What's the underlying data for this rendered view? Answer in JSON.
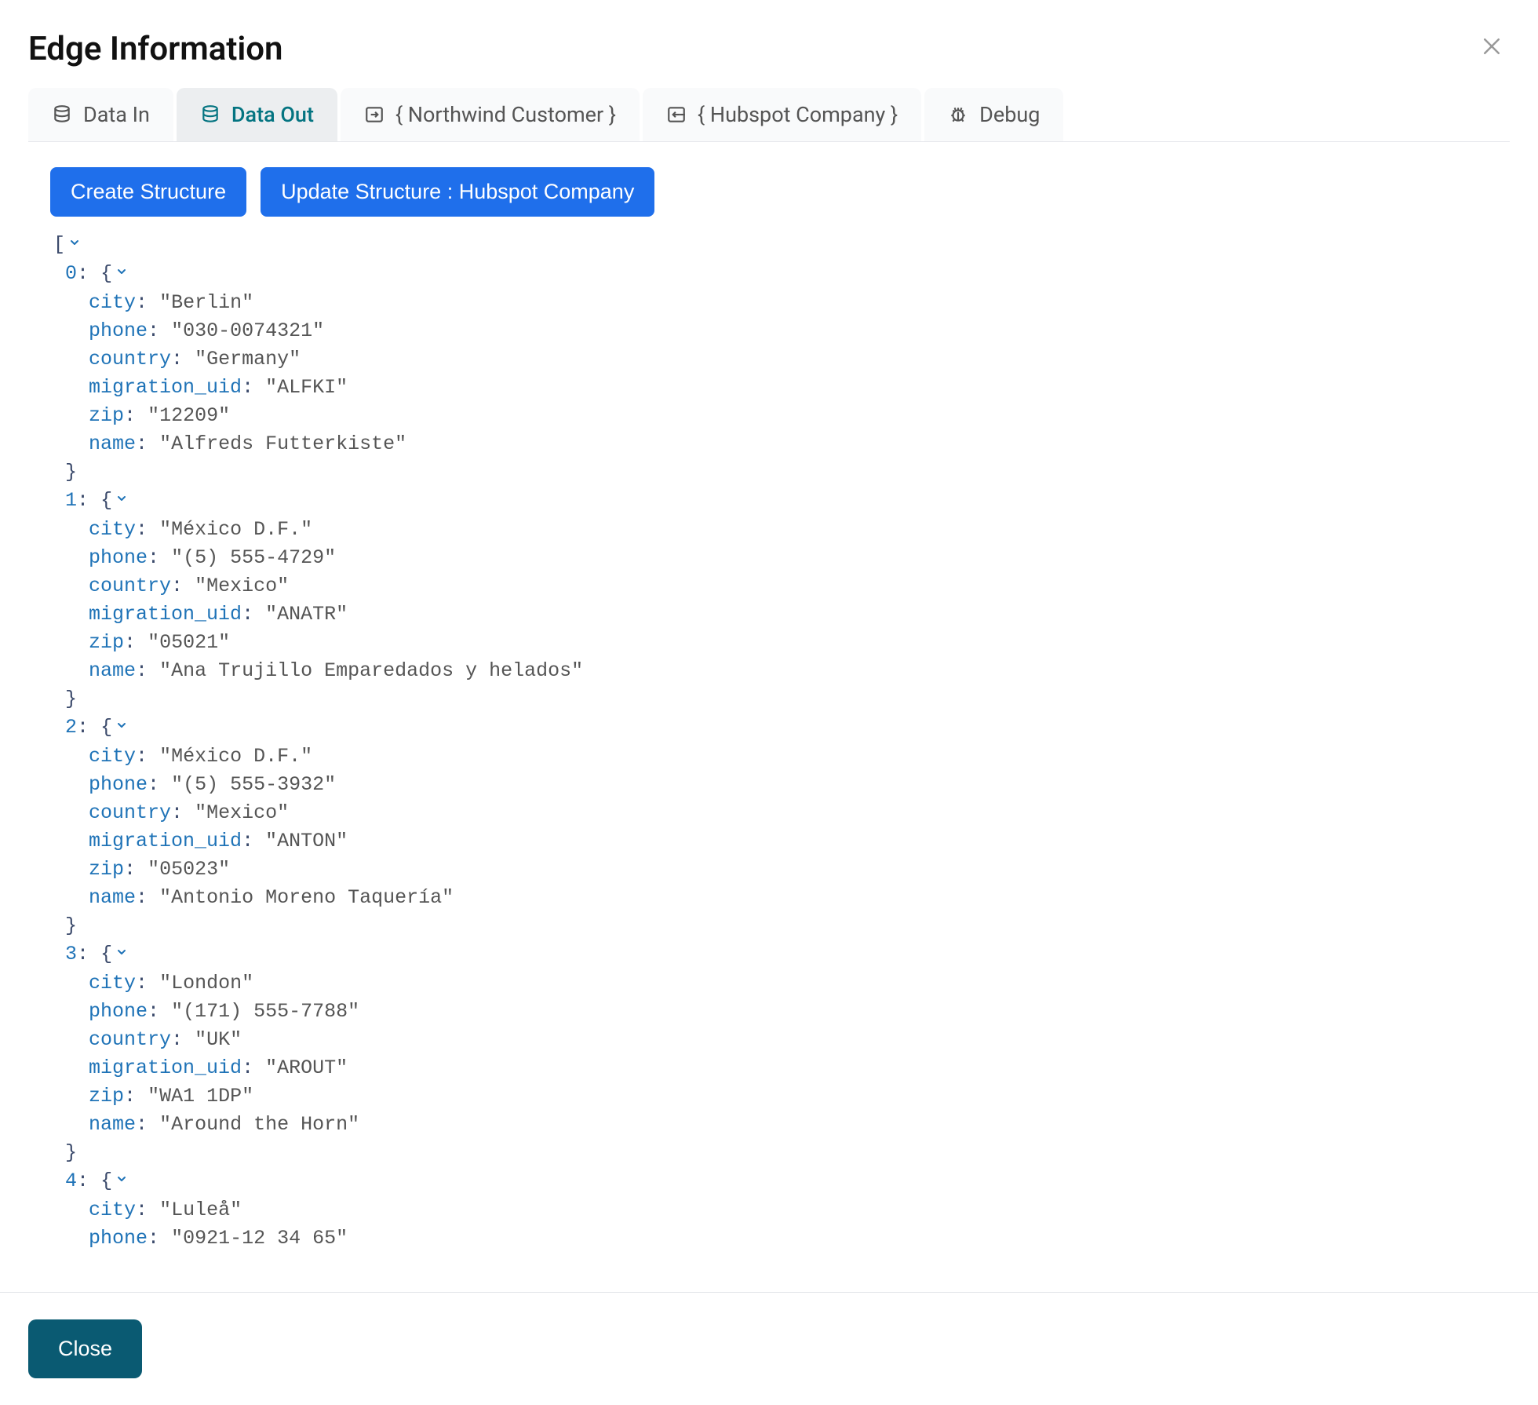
{
  "header": {
    "title": "Edge Information"
  },
  "tabs": [
    {
      "id": "data-in",
      "label": "Data In",
      "icon": "database"
    },
    {
      "id": "data-out",
      "label": "Data Out",
      "icon": "database",
      "active": true
    },
    {
      "id": "northwind",
      "label": "{ Northwind Customer }",
      "icon": "import"
    },
    {
      "id": "hubspot",
      "label": "{ Hubspot Company }",
      "icon": "export"
    },
    {
      "id": "debug",
      "label": "Debug",
      "icon": "bug"
    }
  ],
  "buttons": {
    "create_structure": "Create Structure",
    "update_structure": "Update Structure : Hubspot Company"
  },
  "json_records": [
    {
      "city": "Berlin",
      "phone": "030-0074321",
      "country": "Germany",
      "migration_uid": "ALFKI",
      "zip": "12209",
      "name": "Alfreds Futterkiste"
    },
    {
      "city": "México D.F.",
      "phone": "(5) 555-4729",
      "country": "Mexico",
      "migration_uid": "ANATR",
      "zip": "05021",
      "name": "Ana Trujillo Emparedados y helados"
    },
    {
      "city": "México D.F.",
      "phone": "(5) 555-3932",
      "country": "Mexico",
      "migration_uid": "ANTON",
      "zip": "05023",
      "name": "Antonio Moreno Taquería"
    },
    {
      "city": "London",
      "phone": "(171) 555-7788",
      "country": "UK",
      "migration_uid": "AROUT",
      "zip": "WA1 1DP",
      "name": "Around the Horn"
    },
    {
      "city": "Luleå",
      "phone": "0921-12 34 65"
    }
  ],
  "json_key_order": [
    "city",
    "phone",
    "country",
    "migration_uid",
    "zip",
    "name"
  ],
  "footer": {
    "close_label": "Close"
  }
}
